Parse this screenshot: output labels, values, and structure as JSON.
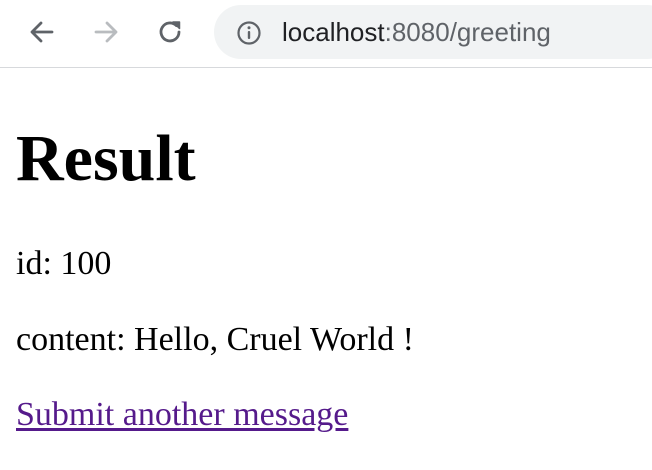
{
  "browser": {
    "url_host": "localhost",
    "url_rest": ":8080/greeting",
    "icons": {
      "back": "arrow-left-icon",
      "forward": "arrow-right-icon",
      "reload": "reload-icon",
      "info": "info-icon"
    },
    "colors": {
      "omnibox_bg": "#f1f3f4",
      "icon_active": "#5f6368",
      "icon_disabled": "#b9bcbf"
    }
  },
  "page": {
    "heading": "Result",
    "id_label": "id:",
    "id_value": "100",
    "content_label": "content:",
    "content_value": "Hello, Cruel World !",
    "link_text": "Submit another message",
    "link_color": "#551a8b"
  }
}
